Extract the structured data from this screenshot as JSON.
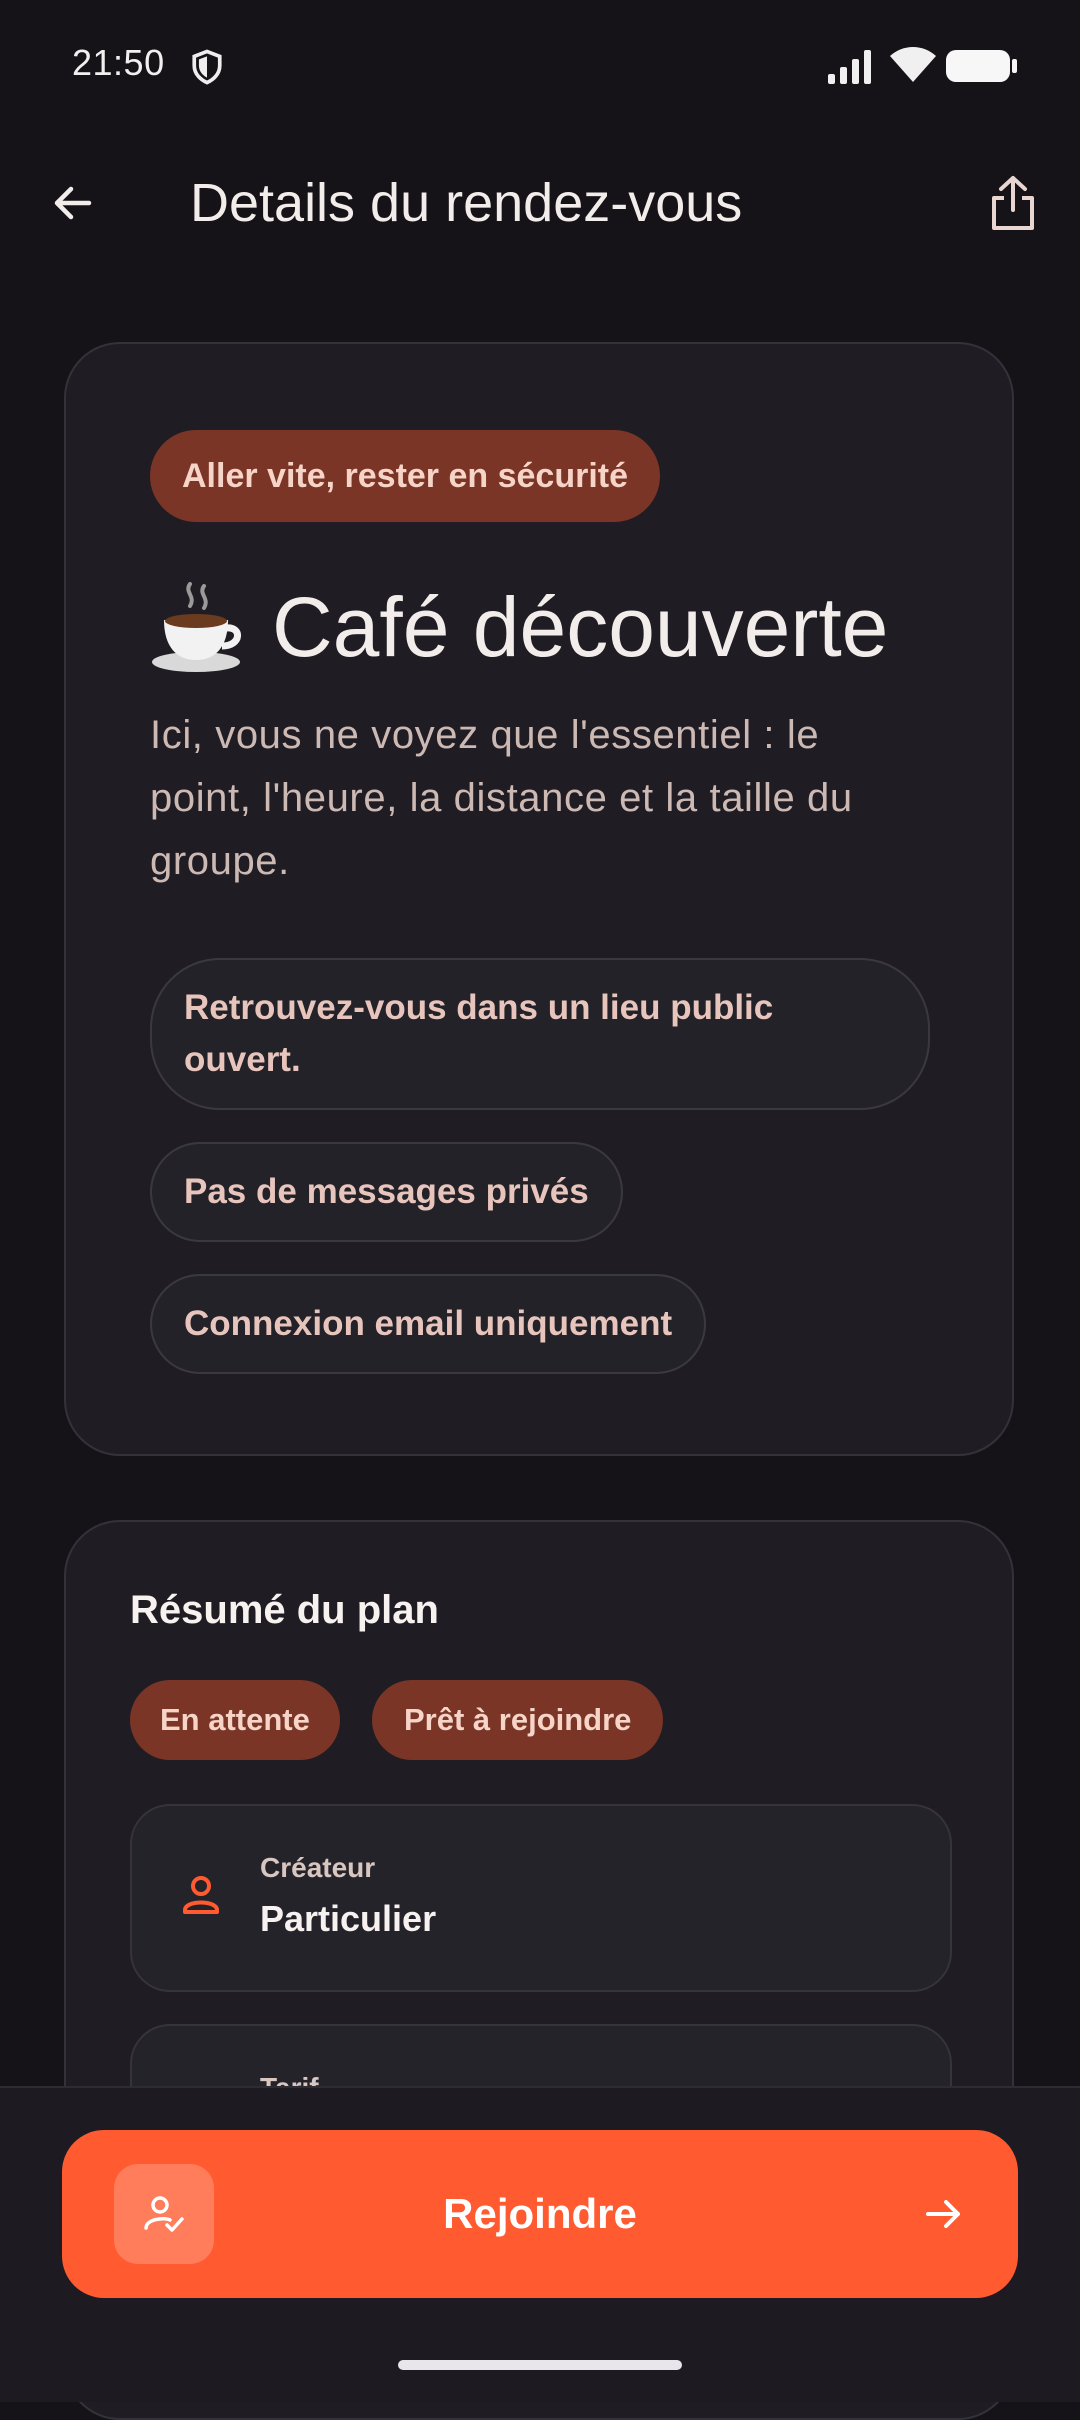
{
  "status_bar": {
    "time": "21:50"
  },
  "header": {
    "title": "Details du rendez-vous"
  },
  "hero": {
    "safety_label": "Aller vite, rester en sécurité",
    "title": "Café découverte",
    "description": "Ici, vous ne voyez que l'essentiel : le point, l'heure, la distance et la taille du groupe.",
    "chips": [
      "Retrouvez-vous dans un lieu public ouvert.",
      "Pas de messages privés",
      "Connexion email uniquement"
    ]
  },
  "plan": {
    "title": "Résumé du plan",
    "statuses": [
      "En attente",
      "Prêt à rejoindre"
    ],
    "rows": [
      {
        "label": "Créateur",
        "value": "Particulier",
        "icon": "person-icon"
      },
      {
        "label": "Tarif",
        "value": ""
      }
    ]
  },
  "action": {
    "join_label": "Rejoindre"
  },
  "colors": {
    "accent": "#ff5a30",
    "pill_bg": "#7a3527",
    "background": "#151318",
    "card": "#1f1d23"
  }
}
